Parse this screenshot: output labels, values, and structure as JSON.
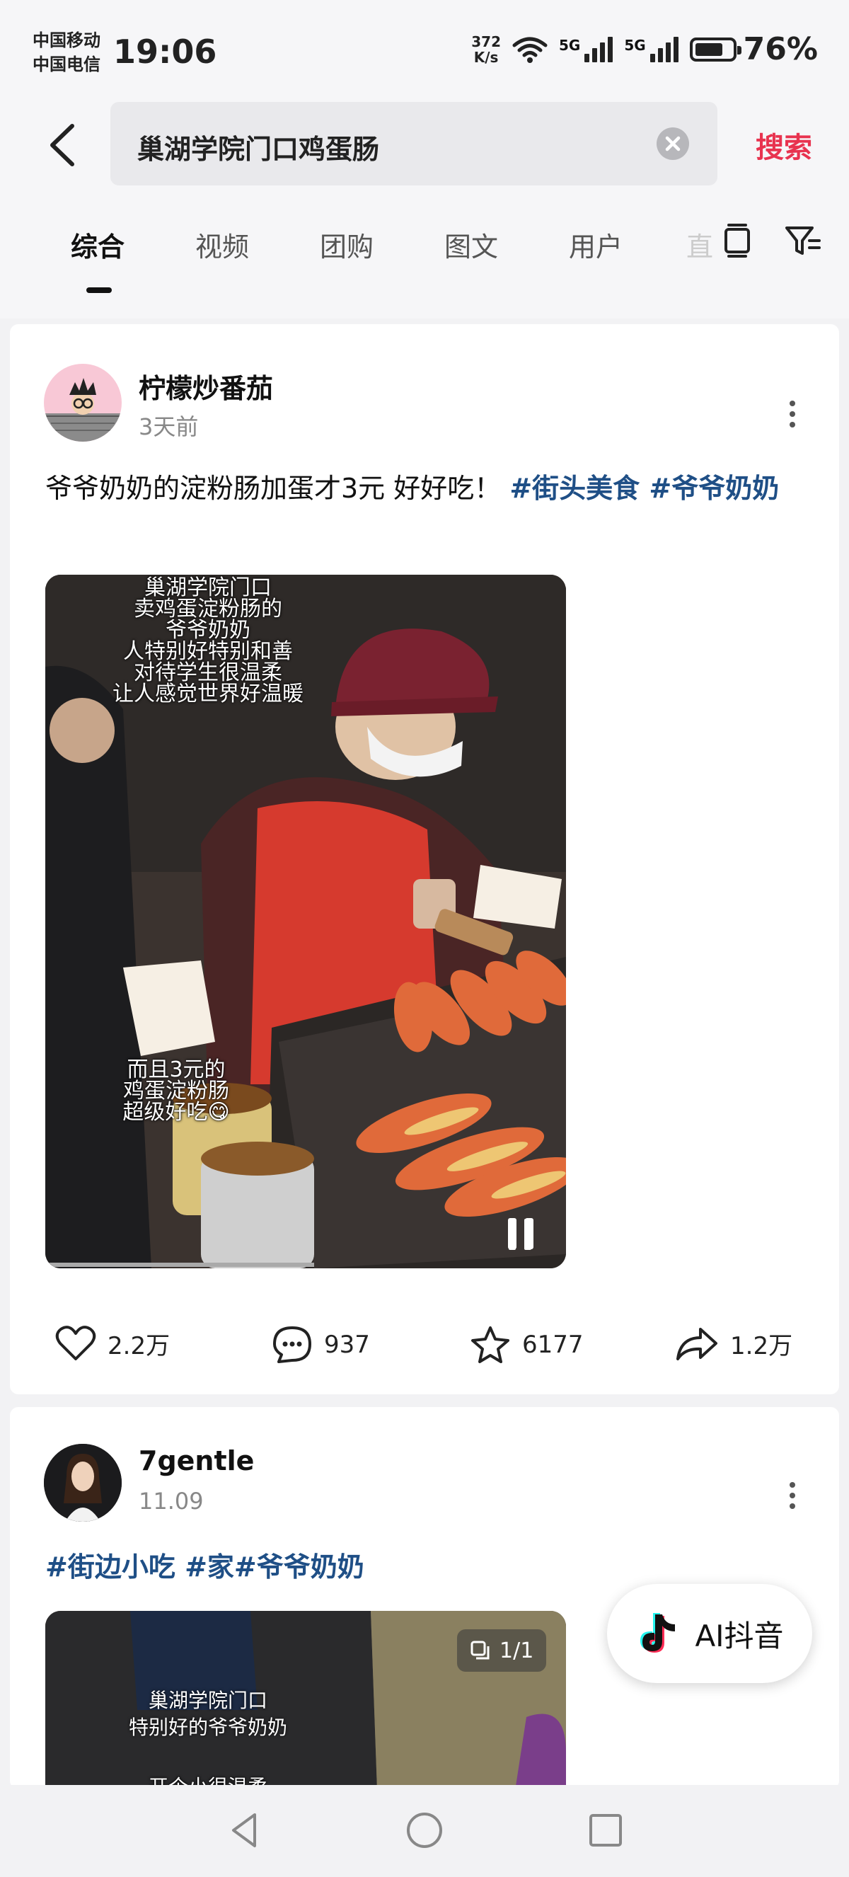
{
  "status_bar": {
    "carrier_1": "中国移动",
    "carrier_2": "中国电信",
    "time": "19:06",
    "net_speed_value": "372",
    "net_speed_unit": "K/s",
    "signal_1": "5G",
    "signal_2": "5G",
    "battery": "76%",
    "battery_level": 0.76
  },
  "search": {
    "query": "巢湖学院门口鸡蛋肠",
    "button_label": "搜索"
  },
  "tabs": [
    "综合",
    "视频",
    "团购",
    "图文",
    "用户"
  ],
  "tabs_partial": "直",
  "posts": [
    {
      "author": "柠檬炒番茄",
      "time": "3天前",
      "caption_text": "爷爷奶奶的淀粉肠加蛋才3元 好好吃！ ",
      "tags": "#街头美食 #爷爷奶奶",
      "overlay_top": "巢湖学院门口\n卖鸡蛋淀粉肠的\n爷爷奶奶\n人特别好特别和善\n对待学生很温柔\n让人感觉世界好温暖",
      "overlay_bottom": "而且3元的\n鸡蛋淀粉肠\n超级好吃😋",
      "likes": "2.2万",
      "comments": "937",
      "favorites": "6177",
      "shares": "1.2万"
    },
    {
      "author": "7gentle",
      "time": "11.09",
      "tags": "#街边小吃 #家#爷爷奶奶",
      "image_count": "1/1",
      "overlay_top": "巢湖学院门口\n特别好的爷爷奶奶",
      "overlay_bottom": "开个小很温柔"
    }
  ],
  "ai_button": {
    "label": "AI抖音"
  },
  "colors": {
    "accent": "#e8334f",
    "tag": "#1f4f86"
  }
}
